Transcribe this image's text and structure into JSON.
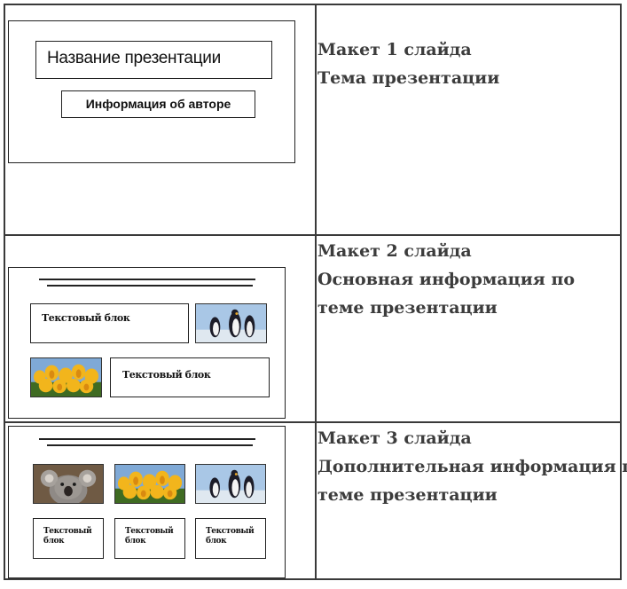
{
  "rows": [
    {
      "layout_title": "Макет 1 слайда",
      "desc_lines": [
        "Тема презентации"
      ],
      "mockup": {
        "title_box": "Название презентации",
        "author_box": "Информация об авторе"
      }
    },
    {
      "layout_title": "Макет 2 слайда",
      "desc_lines": [
        "Основная информация по",
        "теме презентации"
      ],
      "mockup": {
        "textbox_1": "Текстовый блок",
        "textbox_2": "Текстовый блок",
        "images": [
          "penguins-image",
          "tulips-image"
        ]
      }
    },
    {
      "layout_title": "Макет 3 слайда",
      "desc_lines": [
        "Дополнительная информация по",
        "теме презентации"
      ],
      "mockup": {
        "images": [
          "koala-image",
          "tulips-image",
          "penguins-image"
        ],
        "textbox_1": "Текстовый блок",
        "textbox_2": "Текстовый блок",
        "textbox_3": "Текстовый блок"
      }
    }
  ]
}
